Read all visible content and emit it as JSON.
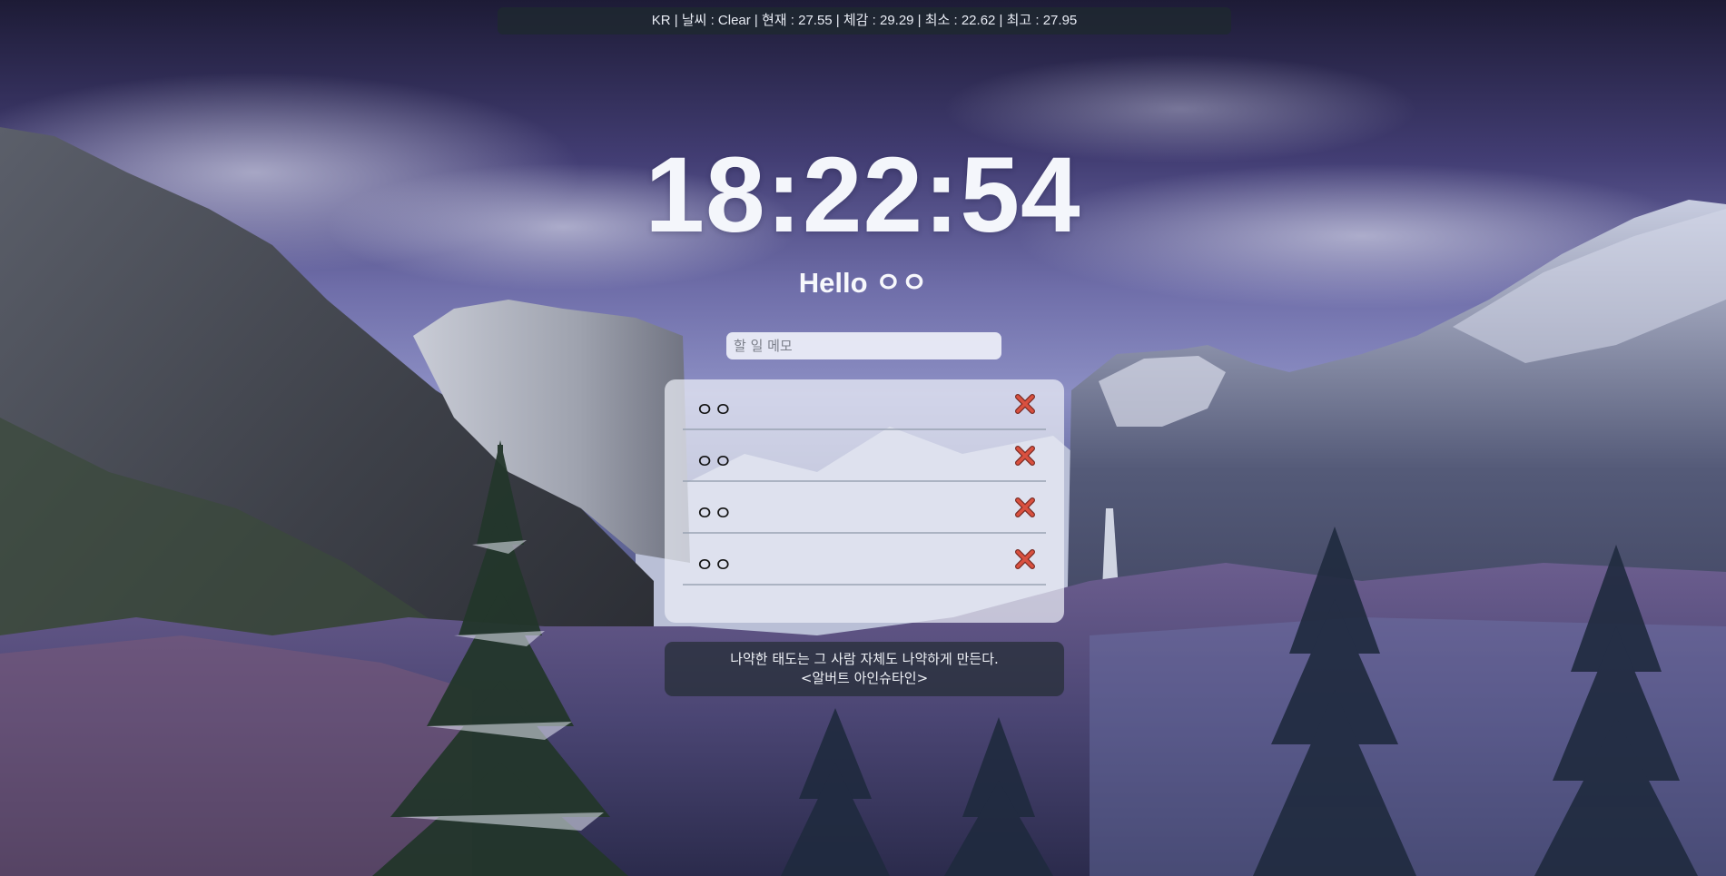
{
  "weather": {
    "text": "KR | 날씨 : Clear | 현재 : 27.55 | 체감 : 29.29 | 최소 : 22.62 | 최고 : 27.95"
  },
  "clock": {
    "time": "18:22:54"
  },
  "greeting": {
    "text": "Hello ㅇㅇ"
  },
  "todo_input": {
    "placeholder": "할 일 메모",
    "value": ""
  },
  "todos": [
    {
      "text": "ㅇㅇ",
      "delete_icon": "close-x-icon"
    },
    {
      "text": "ㅇㅇ",
      "delete_icon": "close-x-icon"
    },
    {
      "text": "ㅇㅇ",
      "delete_icon": "close-x-icon"
    },
    {
      "text": "ㅇㅇ",
      "delete_icon": "close-x-icon"
    }
  ],
  "quote": {
    "text": "나약한 태도는 그 사람 자체도 나약하게 만든다.",
    "author": "<알버트 아인슈타인>"
  },
  "colors": {
    "delete_icon": "#d9503f",
    "delete_icon_outline": "#7a2a22"
  }
}
